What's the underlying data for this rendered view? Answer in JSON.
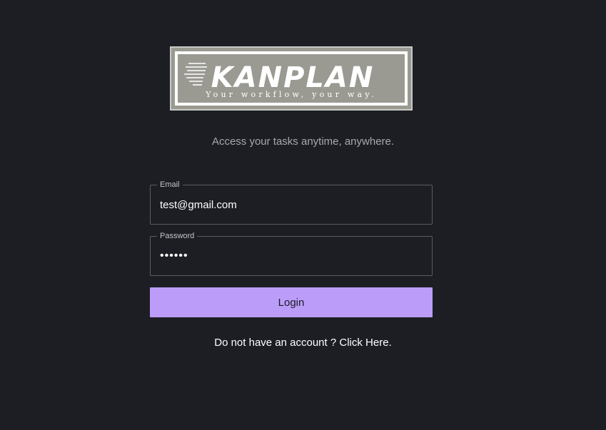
{
  "logo": {
    "brand_text": "KanPlan",
    "slogan": "Your workflow, your way."
  },
  "tagline": "Access your tasks anytime, anywhere.",
  "form": {
    "email": {
      "label": "Email",
      "value": "test@gmail.com"
    },
    "password": {
      "label": "Password",
      "value": "••••••"
    },
    "login_label": "Login"
  },
  "signup": {
    "prompt": "Do not have an account ?",
    "link_text": "Click Here."
  },
  "colors": {
    "background": "#1c1e24",
    "accent": "#bb9df9",
    "logo_bg": "#9a9a93"
  }
}
